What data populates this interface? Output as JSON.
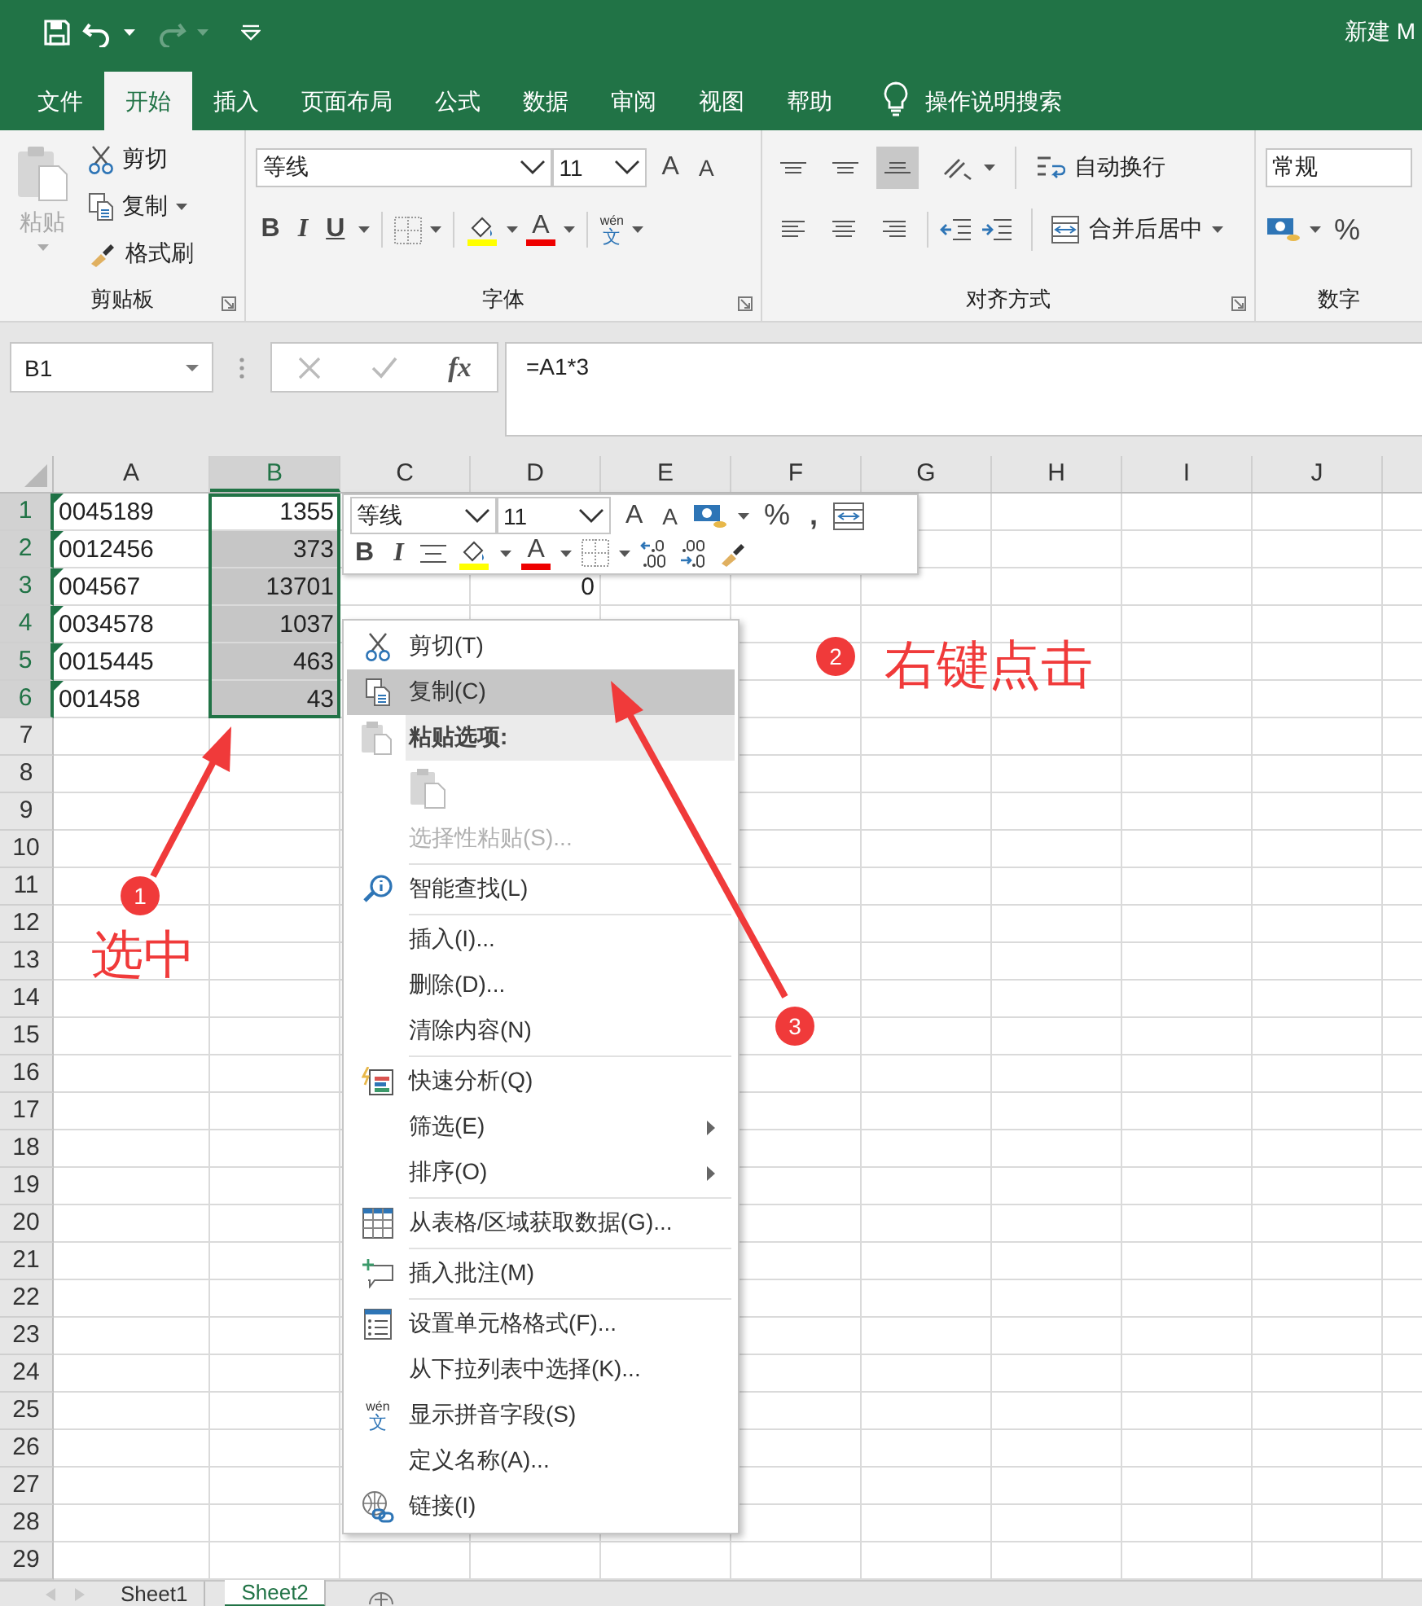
{
  "title_bar": {
    "title": "新建 M"
  },
  "tabs": [
    {
      "label": "文件",
      "selected": false
    },
    {
      "label": "开始",
      "selected": true
    },
    {
      "label": "插入",
      "selected": false
    },
    {
      "label": "页面布局",
      "selected": false
    },
    {
      "label": "公式",
      "selected": false
    },
    {
      "label": "数据",
      "selected": false
    },
    {
      "label": "审阅",
      "selected": false
    },
    {
      "label": "视图",
      "selected": false
    },
    {
      "label": "帮助",
      "selected": false
    }
  ],
  "tell_me": "操作说明搜索",
  "ribbon": {
    "clipboard": {
      "paste": "粘贴",
      "cut": "剪切",
      "copy": "复制",
      "format_painter": "格式刷",
      "label": "剪贴板"
    },
    "font": {
      "name": "等线",
      "size": "11",
      "grow": "A",
      "shrink": "A",
      "bold": "B",
      "italic": "I",
      "underline": "U",
      "font_color_letter": "A",
      "phonetic_top": "wén",
      "phonetic_bottom": "文",
      "label": "字体"
    },
    "alignment": {
      "vertical": [
        {
          "selected": false
        },
        {
          "selected": false
        },
        {
          "selected": true
        }
      ],
      "wrap": "自动换行",
      "merge": "合并后居中",
      "label": "对齐方式"
    },
    "number": {
      "format": "常规",
      "percent": "%",
      "label": "数字"
    }
  },
  "formula_bar": {
    "name_box": "B1",
    "fx": "fx",
    "formula": "=A1*3"
  },
  "sheet": {
    "columns": [
      {
        "label": "A",
        "selected": false
      },
      {
        "label": "B",
        "selected": true
      },
      {
        "label": "C",
        "selected": false
      },
      {
        "label": "D",
        "selected": false
      },
      {
        "label": "E",
        "selected": false
      },
      {
        "label": "F",
        "selected": false
      },
      {
        "label": "G",
        "selected": false
      },
      {
        "label": "H",
        "selected": false
      },
      {
        "label": "I",
        "selected": false
      },
      {
        "label": "J",
        "selected": false
      }
    ],
    "rows": [
      {
        "number": "1",
        "selected": true,
        "a": "0045189",
        "a_error_marker": true,
        "b": "1355"
      },
      {
        "number": "2",
        "selected": true,
        "a": "0012456",
        "a_error_marker": true,
        "b": "373"
      },
      {
        "number": "3",
        "selected": true,
        "a": "004567",
        "a_error_marker": true,
        "b": "13701",
        "d": "0"
      },
      {
        "number": "4",
        "selected": true,
        "a": "0034578",
        "a_error_marker": true,
        "b": "1037"
      },
      {
        "number": "5",
        "selected": true,
        "a": "0015445",
        "a_error_marker": true,
        "b": "463"
      },
      {
        "number": "6",
        "selected": true,
        "a": "001458",
        "a_error_marker": true,
        "b": "43"
      },
      {
        "number": "7",
        "selected": false
      },
      {
        "number": "8",
        "selected": false
      },
      {
        "number": "9",
        "selected": false
      },
      {
        "number": "10",
        "selected": false
      },
      {
        "number": "11",
        "selected": false
      },
      {
        "number": "12",
        "selected": false
      },
      {
        "number": "13",
        "selected": false
      },
      {
        "number": "14",
        "selected": false
      },
      {
        "number": "15",
        "selected": false
      },
      {
        "number": "16",
        "selected": false
      },
      {
        "number": "17",
        "selected": false
      },
      {
        "number": "18",
        "selected": false
      },
      {
        "number": "19",
        "selected": false
      },
      {
        "number": "20",
        "selected": false
      },
      {
        "number": "21",
        "selected": false
      },
      {
        "number": "22",
        "selected": false
      },
      {
        "number": "23",
        "selected": false
      },
      {
        "number": "24",
        "selected": false
      },
      {
        "number": "25",
        "selected": false
      },
      {
        "number": "26",
        "selected": false
      },
      {
        "number": "27",
        "selected": false
      },
      {
        "number": "28",
        "selected": false
      },
      {
        "number": "29",
        "selected": false
      }
    ]
  },
  "mini_toolbar": {
    "font": "等线",
    "size": "11",
    "grow": "A",
    "shrink": "A",
    "percent": "%",
    "comma": ",",
    "bold": "B",
    "italic": "I",
    "font_color_letter": "A"
  },
  "context_menu": [
    {
      "kind": "item",
      "label": "剪切(T)",
      "selected": false,
      "disabled": false,
      "submenu": false
    },
    {
      "kind": "item",
      "label": "复制(C)",
      "selected": true,
      "disabled": false,
      "submenu": false
    },
    {
      "kind": "header",
      "label": "粘贴选项:"
    },
    {
      "kind": "paste-option"
    },
    {
      "kind": "item",
      "label": "选择性粘贴(S)...",
      "selected": false,
      "disabled": true,
      "submenu": false
    },
    {
      "kind": "separator"
    },
    {
      "kind": "item",
      "label": "智能查找(L)",
      "selected": false,
      "disabled": false,
      "submenu": false
    },
    {
      "kind": "separator"
    },
    {
      "kind": "item",
      "label": "插入(I)...",
      "selected": false,
      "disabled": false,
      "submenu": false
    },
    {
      "kind": "item",
      "label": "删除(D)...",
      "selected": false,
      "disabled": false,
      "submenu": false
    },
    {
      "kind": "item",
      "label": "清除内容(N)",
      "selected": false,
      "disabled": false,
      "submenu": false
    },
    {
      "kind": "separator"
    },
    {
      "kind": "item",
      "label": "快速分析(Q)",
      "selected": false,
      "disabled": false,
      "submenu": false
    },
    {
      "kind": "item",
      "label": "筛选(E)",
      "selected": false,
      "disabled": false,
      "submenu": true
    },
    {
      "kind": "item",
      "label": "排序(O)",
      "selected": false,
      "disabled": false,
      "submenu": true
    },
    {
      "kind": "separator"
    },
    {
      "kind": "item",
      "label": "从表格/区域获取数据(G)...",
      "selected": false,
      "disabled": false,
      "submenu": false
    },
    {
      "kind": "separator"
    },
    {
      "kind": "item",
      "label": "插入批注(M)",
      "selected": false,
      "disabled": false,
      "submenu": false
    },
    {
      "kind": "separator"
    },
    {
      "kind": "item",
      "label": "设置单元格格式(F)...",
      "selected": false,
      "disabled": false,
      "submenu": false
    },
    {
      "kind": "item",
      "label": "从下拉列表中选择(K)...",
      "selected": false,
      "disabled": false,
      "submenu": false
    },
    {
      "kind": "phonetic-item",
      "label": "显示拼音字段(S)",
      "icon_top": "wén",
      "icon_bottom": "文",
      "selected": false,
      "disabled": false,
      "submenu": false
    },
    {
      "kind": "item",
      "label": "定义名称(A)...",
      "selected": false,
      "disabled": false,
      "submenu": false
    },
    {
      "kind": "item",
      "label": "链接(I)",
      "selected": false,
      "disabled": false,
      "submenu": false
    }
  ],
  "sheet_tabs": [
    {
      "label": "Sheet1",
      "selected": false
    },
    {
      "label": "Sheet2",
      "selected": true
    }
  ],
  "annotations": [
    {
      "number": "1",
      "label": "选中"
    },
    {
      "number": "2",
      "label": "右键点击"
    },
    {
      "number": "3"
    }
  ]
}
